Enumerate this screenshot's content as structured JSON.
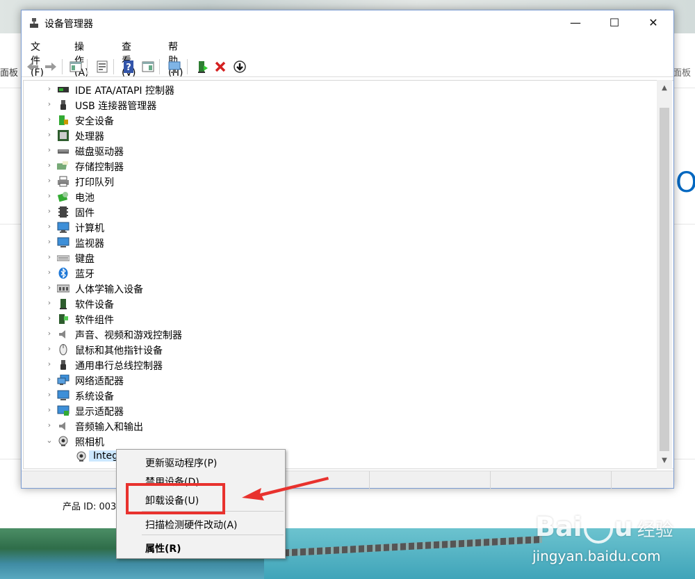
{
  "window": {
    "title": "设备管理器",
    "controls": {
      "minimize": "—",
      "maximize": "☐",
      "close": "✕"
    }
  },
  "menubar": [
    {
      "label": "文件(F)"
    },
    {
      "label": "操作(A)"
    },
    {
      "label": "查看(V)"
    },
    {
      "label": "帮助(H)"
    }
  ],
  "background": {
    "breadcrumb_left": "面板",
    "breadcrumb_right": "面板",
    "partial_heading": "O",
    "product_id_text": "产品 ID: 003",
    "watermark": "Bai",
    "watermark_tail": "u",
    "watermark_cn": "经验",
    "watermark_url": "jingyan.baidu.com"
  },
  "tree": {
    "items": [
      {
        "label": "IDE ATA/ATAPI 控制器",
        "icon": "ide-controller-icon",
        "expanded": false
      },
      {
        "label": "USB 连接器管理器",
        "icon": "usb-icon",
        "expanded": false
      },
      {
        "label": "安全设备",
        "icon": "security-device-icon",
        "expanded": false
      },
      {
        "label": "处理器",
        "icon": "processor-icon",
        "expanded": false
      },
      {
        "label": "磁盘驱动器",
        "icon": "disk-drive-icon",
        "expanded": false
      },
      {
        "label": "存储控制器",
        "icon": "storage-controller-icon",
        "expanded": false
      },
      {
        "label": "打印队列",
        "icon": "printer-icon",
        "expanded": false
      },
      {
        "label": "电池",
        "icon": "battery-icon",
        "expanded": false
      },
      {
        "label": "固件",
        "icon": "firmware-icon",
        "expanded": false
      },
      {
        "label": "计算机",
        "icon": "computer-icon",
        "expanded": false
      },
      {
        "label": "监视器",
        "icon": "monitor-icon",
        "expanded": false
      },
      {
        "label": "键盘",
        "icon": "keyboard-icon",
        "expanded": false
      },
      {
        "label": "蓝牙",
        "icon": "bluetooth-icon",
        "expanded": false
      },
      {
        "label": "人体学输入设备",
        "icon": "hid-icon",
        "expanded": false
      },
      {
        "label": "软件设备",
        "icon": "software-device-icon",
        "expanded": false
      },
      {
        "label": "软件组件",
        "icon": "software-component-icon",
        "expanded": false
      },
      {
        "label": "声音、视频和游戏控制器",
        "icon": "sound-icon",
        "expanded": false
      },
      {
        "label": "鼠标和其他指针设备",
        "icon": "mouse-icon",
        "expanded": false
      },
      {
        "label": "通用串行总线控制器",
        "icon": "usb-controller-icon",
        "expanded": false
      },
      {
        "label": "网络适配器",
        "icon": "network-adapter-icon",
        "expanded": false
      },
      {
        "label": "系统设备",
        "icon": "system-device-icon",
        "expanded": false
      },
      {
        "label": "显示适配器",
        "icon": "display-adapter-icon",
        "expanded": false
      },
      {
        "label": "音频输入和输出",
        "icon": "audio-io-icon",
        "expanded": false
      },
      {
        "label": "照相机",
        "icon": "camera-icon",
        "expanded": true
      }
    ],
    "selected_child": {
      "label": "Integrated Camera",
      "icon": "webcam-icon"
    }
  },
  "context_menu": {
    "items": [
      {
        "label": "更新驱动程序(P)",
        "bold": false
      },
      {
        "label": "禁用设备(D)",
        "bold": false
      },
      {
        "label": "卸载设备(U)",
        "bold": false
      },
      {
        "label": "扫描检测硬件改动(A)",
        "bold": false
      },
      {
        "label": "属性(R)",
        "bold": true
      }
    ]
  },
  "colors": {
    "highlight_box": "#e8322e",
    "selection": "#cce8ff",
    "accent": "#0067c0"
  }
}
